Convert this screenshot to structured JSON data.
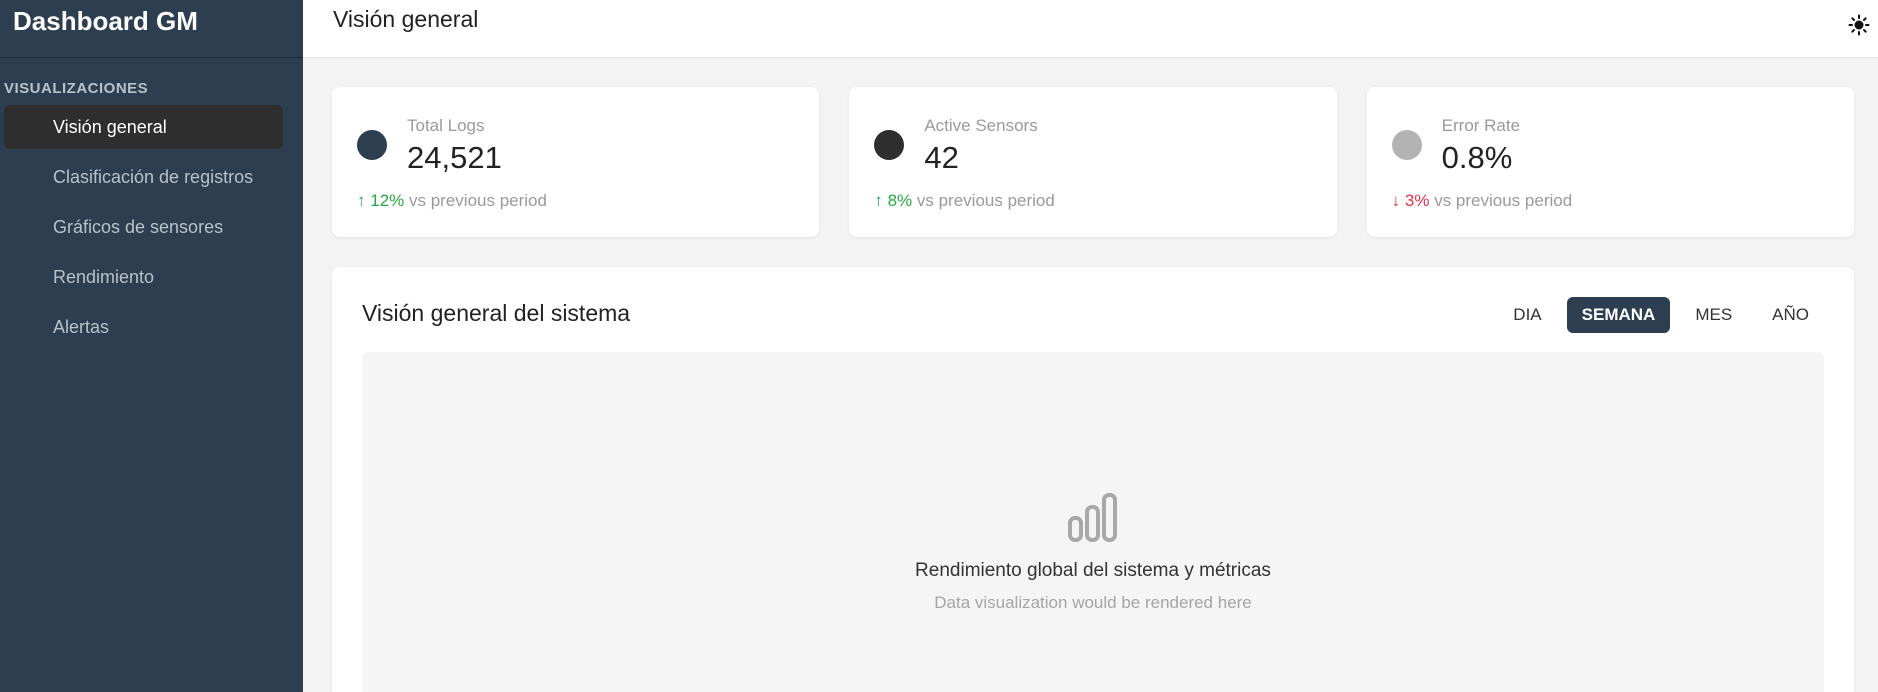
{
  "sidebar": {
    "brand": "Dashboard GM",
    "section_label": "VISUALIZACIONES",
    "items": [
      {
        "label": "Visión general",
        "active": true
      },
      {
        "label": "Clasificación de registros",
        "active": false
      },
      {
        "label": "Gráficos de sensores",
        "active": false
      },
      {
        "label": "Rendimiento",
        "active": false
      },
      {
        "label": "Alertas",
        "active": false
      }
    ]
  },
  "header": {
    "title": "Visión general",
    "theme_icon": "sun-icon"
  },
  "stats": [
    {
      "label": "Total Logs",
      "value": "24,521",
      "trend_arrow": "↑",
      "trend_value": "12%",
      "trend_dir": "up",
      "trend_text": "vs previous period",
      "dot_color": "#2c3e50"
    },
    {
      "label": "Active Sensors",
      "value": "42",
      "trend_arrow": "↑",
      "trend_value": "8%",
      "trend_dir": "up",
      "trend_text": "vs previous period",
      "dot_color": "#2e2e2e"
    },
    {
      "label": "Error Rate",
      "value": "0.8%",
      "trend_arrow": "↓",
      "trend_value": "3%",
      "trend_dir": "down",
      "trend_text": "vs previous period",
      "dot_color": "#b3b3b3"
    }
  ],
  "panel": {
    "title": "Visión general del sistema",
    "tabs": [
      {
        "label": "DIA",
        "active": false
      },
      {
        "label": "SEMANA",
        "active": true
      },
      {
        "label": "MES",
        "active": false
      },
      {
        "label": "AÑO",
        "active": false
      }
    ],
    "placeholder_icon": "bar-chart-icon",
    "placeholder_title": "Rendimiento global del sistema y métricas",
    "placeholder_subtitle": "Data visualization would be rendered here"
  },
  "colors": {
    "sidebar_bg": "#2c3e50",
    "active_tab_bg": "#2c3e50",
    "trend_up": "#28a745",
    "trend_down": "#dc3545"
  }
}
